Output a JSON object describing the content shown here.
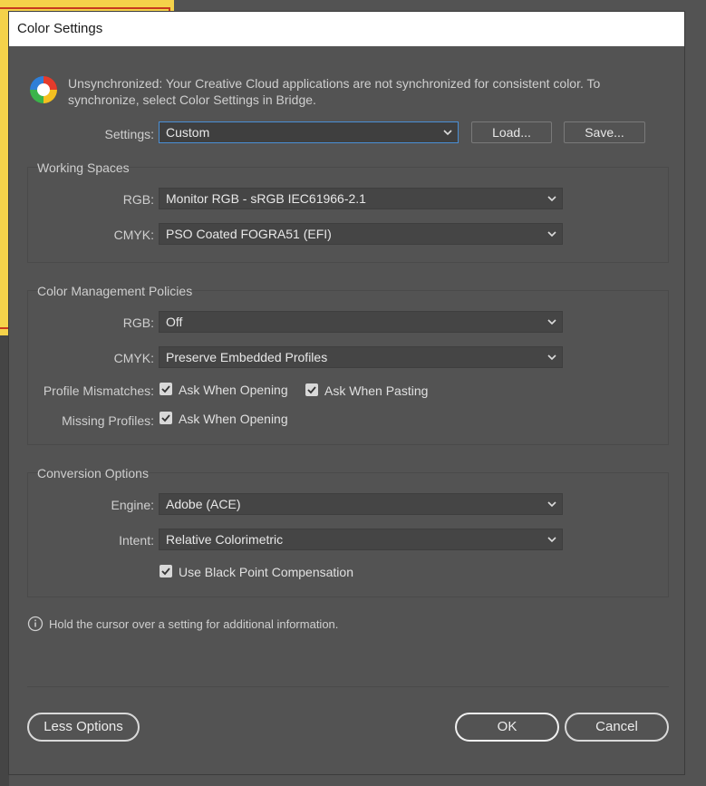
{
  "window": {
    "title": "Color Settings"
  },
  "notice": {
    "text": "Unsynchronized: Your Creative Cloud applications are not synchronized for consistent color. To synchronize, select Color Settings in Bridge."
  },
  "settings": {
    "label": "Settings:",
    "value": "Custom",
    "load_label": "Load...",
    "save_label": "Save..."
  },
  "working_spaces": {
    "title": "Working Spaces",
    "rgb_label": "RGB:",
    "rgb_value": "Monitor RGB - sRGB IEC61966-2.1",
    "cmyk_label": "CMYK:",
    "cmyk_value": "PSO Coated FOGRA51 (EFI)"
  },
  "policies": {
    "title": "Color Management Policies",
    "rgb_label": "RGB:",
    "rgb_value": "Off",
    "cmyk_label": "CMYK:",
    "cmyk_value": "Preserve Embedded Profiles",
    "mismatch_label": "Profile Mismatches:",
    "mismatch_open": "Ask When Opening",
    "mismatch_paste": "Ask When Pasting",
    "missing_label": "Missing Profiles:",
    "missing_open": "Ask When Opening"
  },
  "conversion": {
    "title": "Conversion Options",
    "engine_label": "Engine:",
    "engine_value": "Adobe (ACE)",
    "intent_label": "Intent:",
    "intent_value": "Relative Colorimetric",
    "bpc_label": "Use Black Point Compensation"
  },
  "info": {
    "text": "Hold the cursor over a setting for additional information."
  },
  "footer": {
    "less_options": "Less Options",
    "ok": "OK",
    "cancel": "Cancel"
  },
  "colors": {
    "focus_border": "#4a8fd6",
    "dialog_bg": "#535353",
    "titlebar_bg": "#ffffff"
  }
}
